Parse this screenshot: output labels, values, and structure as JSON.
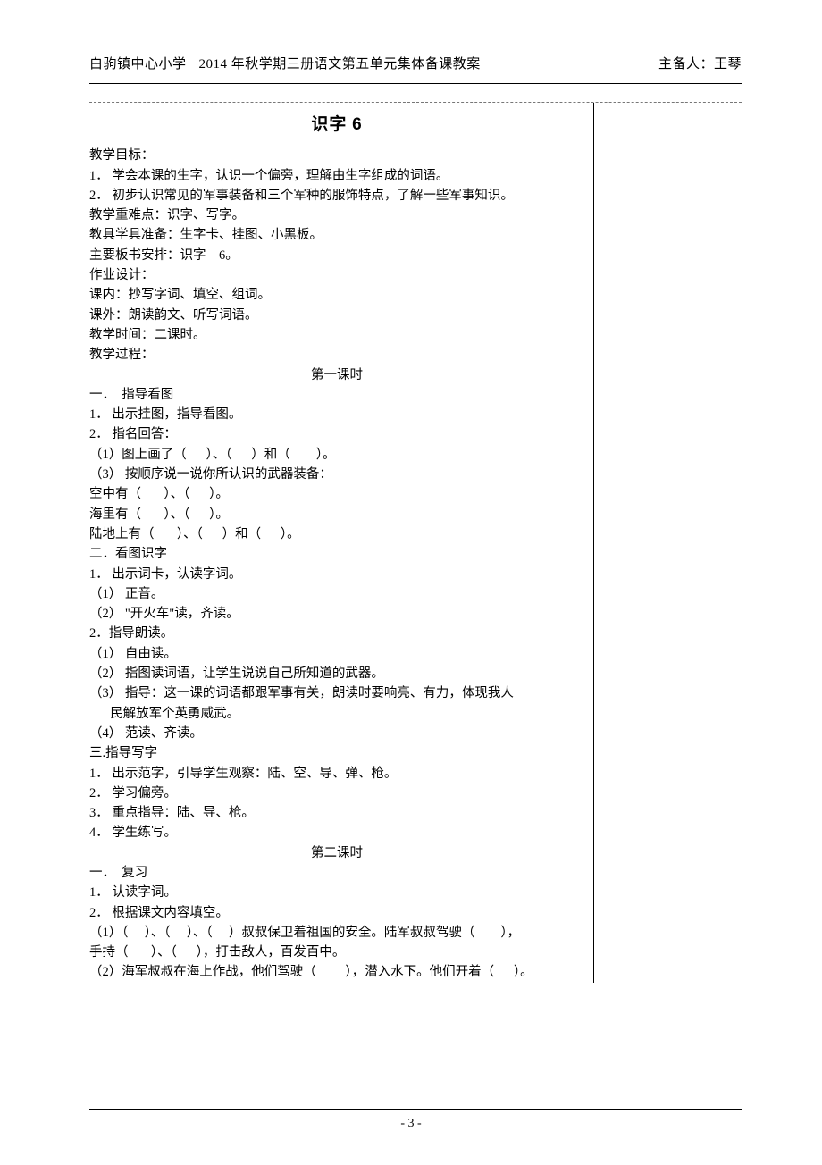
{
  "header": {
    "school": "白驹镇中心小学",
    "term": "2014 年秋学期三册语文第五单元集体备课教案",
    "preparer_label": "主备人：王琴"
  },
  "title": {
    "prefix": "识字",
    "number": "6"
  },
  "body": [
    {
      "t": "line",
      "v": "教学目标："
    },
    {
      "t": "line",
      "v": "1． 学会本课的生字，认识一个偏旁，理解由生字组成的词语。"
    },
    {
      "t": "line",
      "v": "2． 初步认识常见的军事装备和三个军种的服饰特点，了解一些军事知识。"
    },
    {
      "t": "line",
      "v": "教学重难点：识字、写字。"
    },
    {
      "t": "line",
      "v": "教具学具准备：生字卡、挂图、小黑板。"
    },
    {
      "t": "line",
      "v": "主要板书安排：识字    6。"
    },
    {
      "t": "line",
      "v": "作业设计："
    },
    {
      "t": "line",
      "v": "课内：抄写字词、填空、组词。"
    },
    {
      "t": "line",
      "v": "课外：朗读韵文、听写词语。"
    },
    {
      "t": "line",
      "v": "教学时间：二课时。"
    },
    {
      "t": "line",
      "v": "教学过程："
    },
    {
      "t": "center",
      "v": "第一课时"
    },
    {
      "t": "line",
      "v": "一．  指导看图"
    },
    {
      "t": "line",
      "v": "1． 出示挂图，指导看图。"
    },
    {
      "t": "line",
      "v": "2． 指名回答："
    },
    {
      "t": "line",
      "v": "（1）图上画了（      ）、（      ）和（        ）。"
    },
    {
      "t": "line",
      "v": "（3） 按顺序说一说你所认识的武器装备："
    },
    {
      "t": "line",
      "v": "空中有（       ）、（      ）。"
    },
    {
      "t": "line",
      "v": "海里有（       ）、（      ）。"
    },
    {
      "t": "line",
      "v": "陆地上有（       ）、（      ）和（      ）。"
    },
    {
      "t": "line",
      "v": "二．看图识字"
    },
    {
      "t": "line",
      "v": "1． 出示词卡，认读字词。"
    },
    {
      "t": "line",
      "v": "（1） 正音。"
    },
    {
      "t": "line",
      "v": "（2） \"开火车\"读，齐读。"
    },
    {
      "t": "line",
      "v": "2．指导朗读。"
    },
    {
      "t": "line",
      "v": "（1） 自由读。"
    },
    {
      "t": "line",
      "v": "（2） 指图读词语，让学生说说自己所知道的武器。"
    },
    {
      "t": "line",
      "v": "（3） 指导：这一课的词语都跟军事有关，朗读时要响亮、有力，体现我人"
    },
    {
      "t": "indent",
      "v": "民解放军个英勇威武。"
    },
    {
      "t": "line",
      "v": "（4） 范读、齐读。"
    },
    {
      "t": "line",
      "v": "三.指导写字"
    },
    {
      "t": "line",
      "v": "1． 出示范字，引导学生观察：陆、空、导、弹、枪。"
    },
    {
      "t": "line",
      "v": "2． 学习偏旁。"
    },
    {
      "t": "line",
      "v": "3． 重点指导：陆、导、枪。"
    },
    {
      "t": "line",
      "v": "4． 学生练写。"
    },
    {
      "t": "center",
      "v": "第二课时"
    },
    {
      "t": "line",
      "v": "一．  复习"
    },
    {
      "t": "line",
      "v": "1． 认读字词。"
    },
    {
      "t": "line",
      "v": "2． 根据课文内容填空。"
    },
    {
      "t": "line",
      "v": "（1）（     ）、（     ）、（     ）叔叔保卫着祖国的安全。陆军叔叔驾驶（        ），"
    },
    {
      "t": "line",
      "v": "手持（       ）、（      ），打击敌人，百发百中。"
    },
    {
      "t": "line",
      "v": "（2）海军叔叔在海上作战，他们驾驶（         ），潜入水下。他们开着（      ）。"
    }
  ],
  "footer": {
    "page": "- 3 -"
  }
}
